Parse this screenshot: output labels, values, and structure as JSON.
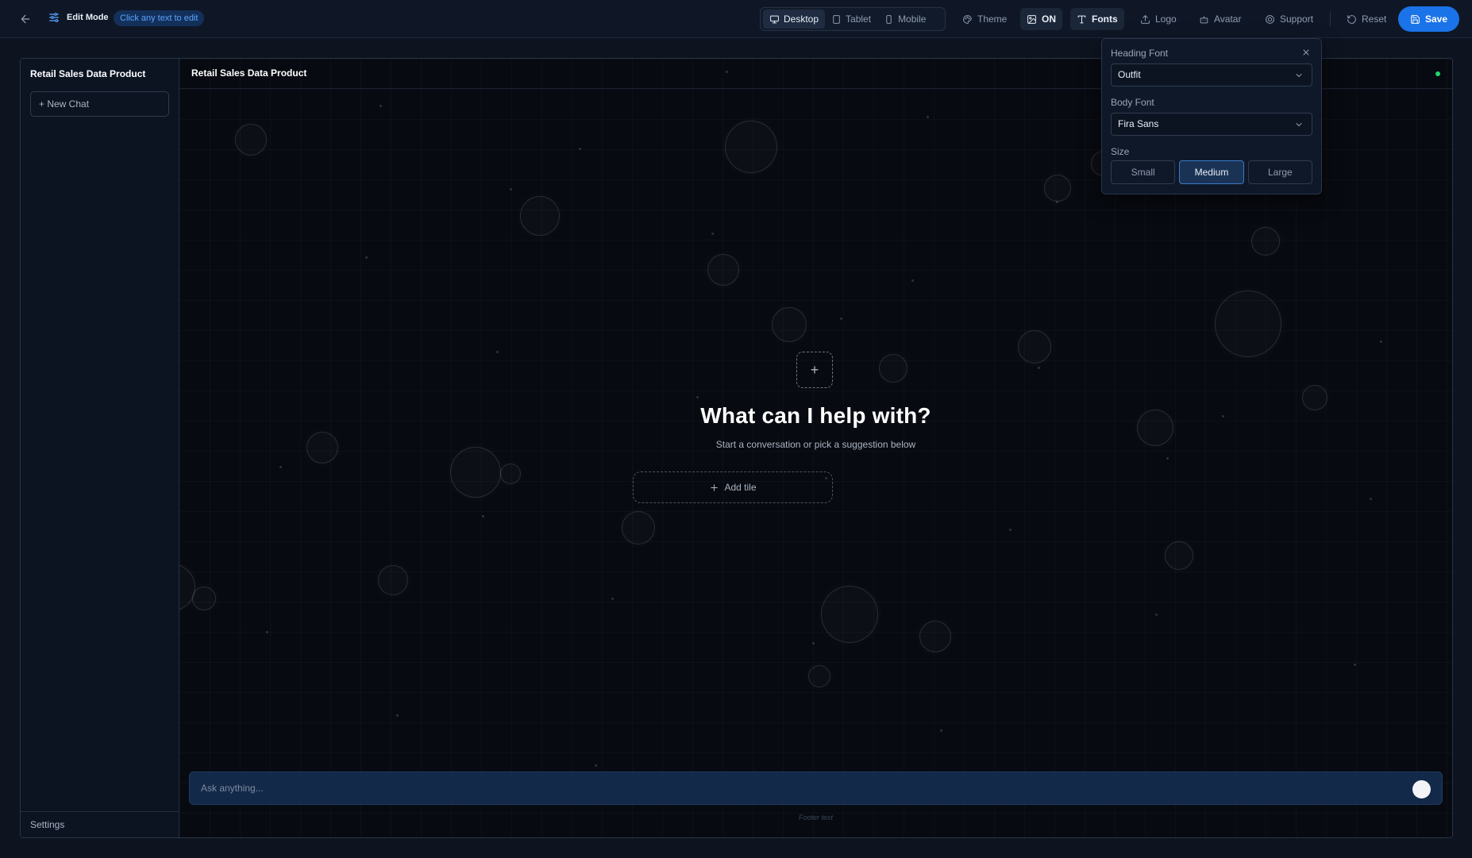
{
  "topbar": {
    "edit_mode_label": "Edit Mode",
    "edit_hint": "Click any text to edit",
    "devices": [
      {
        "label": "Desktop",
        "icon": "monitor-icon",
        "active": true
      },
      {
        "label": "Tablet",
        "icon": "tablet-icon",
        "active": false
      },
      {
        "label": "Mobile",
        "icon": "phone-icon",
        "active": false
      }
    ],
    "theme_label": "Theme",
    "background_toggle_label": "ON",
    "fonts_label": "Fonts",
    "logo_label": "Logo",
    "avatar_label": "Avatar",
    "support_label": "Support",
    "reset_label": "Reset",
    "save_label": "Save"
  },
  "sidebar": {
    "title": "Retail Sales Data Product",
    "new_chat_label": "+ New Chat",
    "settings_label": "Settings"
  },
  "main": {
    "title": "Retail Sales Data Product",
    "hero_add_symbol": "+",
    "hero_title": "What can I help with?",
    "hero_subtitle": "Start a conversation or pick a suggestion below",
    "add_tile_label": "Add tile",
    "ask_placeholder": "Ask anything...",
    "footer_text": "Footer text"
  },
  "fonts_popover": {
    "heading_font_label": "Heading Font",
    "heading_font_value": "Outfit",
    "body_font_label": "Body Font",
    "body_font_value": "Fira Sans",
    "size_label": "Size",
    "sizes": [
      "Small",
      "Medium",
      "Large"
    ],
    "selected_size": "Medium"
  },
  "colors": {
    "accent": "#1a73e8",
    "background": "#0d1420",
    "status_online": "#22d36b"
  }
}
